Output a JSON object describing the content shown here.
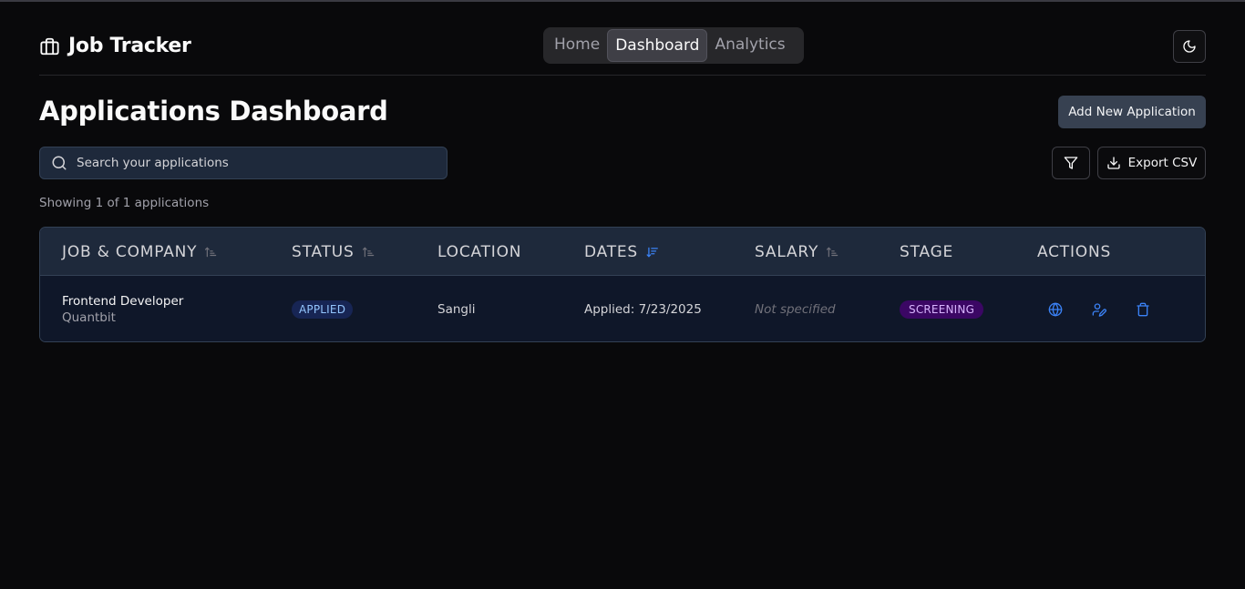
{
  "app": {
    "title": "Job Tracker"
  },
  "nav": {
    "items": [
      "Home",
      "Dashboard",
      "Analytics"
    ],
    "active": "Dashboard"
  },
  "page": {
    "title": "Applications Dashboard",
    "add_button": "Add New Application",
    "search_placeholder": "Search your applications",
    "export_label": "Export CSV",
    "count_text": "Showing 1 of 1 applications"
  },
  "table": {
    "headers": {
      "job": "JOB & COMPANY",
      "status": "STATUS",
      "location": "LOCATION",
      "dates": "DATES",
      "salary": "SALARY",
      "stage": "STAGE",
      "actions": "ACTIONS"
    },
    "sorted_by": "DATES",
    "rows": [
      {
        "job_title": "Frontend Developer",
        "company": "Quantbit",
        "status": "APPLIED",
        "location": "Sangli",
        "dates": "Applied: 7/23/2025",
        "salary": "Not specified",
        "stage": "SCREENING"
      }
    ]
  },
  "icons": {
    "brand": "briefcase-icon",
    "theme": "moon-icon",
    "search": "search-icon",
    "filter": "filter-icon",
    "export": "download-icon",
    "sort": "sort-icon",
    "row_actions": [
      "globe-icon",
      "user-edit-icon",
      "trash-icon"
    ]
  },
  "colors": {
    "background": "#09090b",
    "accent_blue": "#3b82f6",
    "status_applied_bg": "#172554",
    "status_applied_fg": "#93c5fd",
    "stage_bg": "#3b0764",
    "stage_fg": "#d8b4fe"
  }
}
